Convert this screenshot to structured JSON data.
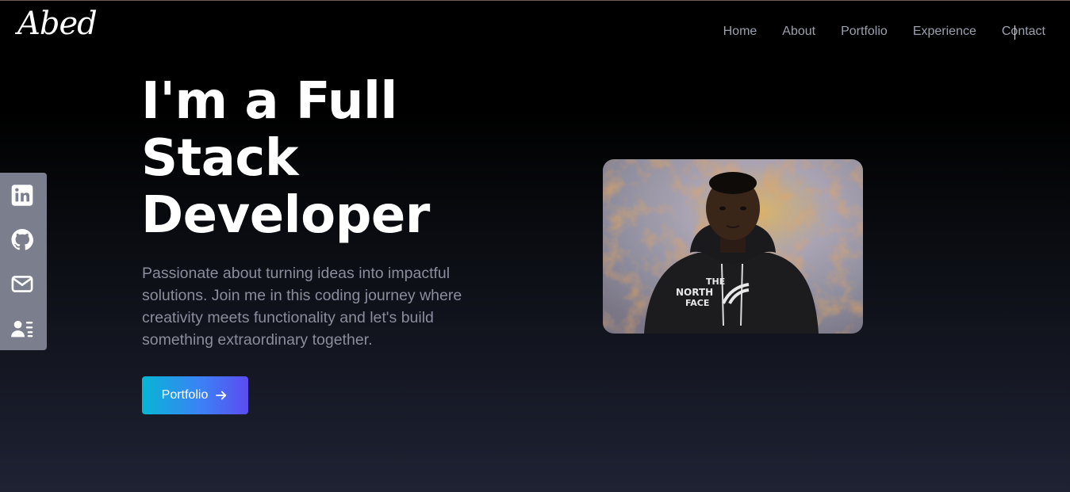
{
  "brand": {
    "logo_text": "Abed"
  },
  "nav": {
    "items": [
      {
        "label": "Home"
      },
      {
        "label": "About"
      },
      {
        "label": "Portfolio"
      },
      {
        "label": "Experience"
      },
      {
        "label": "Contact"
      }
    ]
  },
  "social": {
    "icons": [
      "linkedin-icon",
      "github-icon",
      "mail-icon",
      "resume-icon"
    ]
  },
  "hero": {
    "title_lines": [
      "I'm a Full",
      "Stack",
      "Developer"
    ],
    "description": "Passionate about turning ideas into impactful solutions. Join me in this coding journey where creativity meets functionality and let's build something extraordinary together.",
    "cta_label": "Portfolio",
    "cta_icon": "arrow-right-icon"
  },
  "photo": {
    "shirt_text_top": "THE",
    "shirt_text_mid": "NORTH",
    "shirt_text_bot": "FACE"
  },
  "colors": {
    "social_bar": "#7b7e8c",
    "nav_text": "#9aa0ad",
    "cta_start": "#06b6d4",
    "cta_end": "#5b4cf0"
  }
}
